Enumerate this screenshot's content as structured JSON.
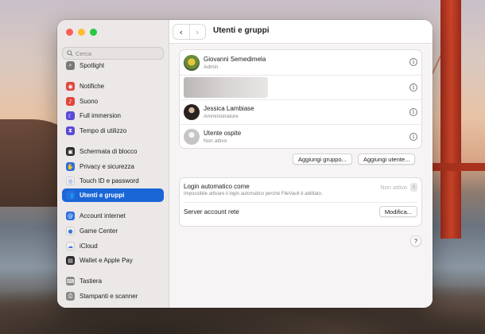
{
  "window": {
    "title": "Utenti e gruppi"
  },
  "search": {
    "placeholder": "Cerca"
  },
  "sidebar": {
    "items": [
      {
        "label": "Spotlight",
        "icon": "spotlight-icon",
        "color": "#7b7878",
        "glyph": "⌕"
      },
      {
        "label": "Notifiche",
        "icon": "notifications-icon",
        "color": "#e2463c",
        "glyph": "◉"
      },
      {
        "label": "Suono",
        "icon": "sound-icon",
        "color": "#e2463c",
        "glyph": "♪"
      },
      {
        "label": "Full immersion",
        "icon": "focus-icon",
        "color": "#5a4ad6",
        "glyph": "☾"
      },
      {
        "label": "Tempo di utilizzo",
        "icon": "screen-time-icon",
        "color": "#5a4ad6",
        "glyph": "⧗"
      },
      {
        "label": "Schermata di blocco",
        "icon": "lock-screen-icon",
        "color": "#2a2a2a",
        "glyph": "▣"
      },
      {
        "label": "Privacy e sicurezza",
        "icon": "privacy-icon",
        "color": "#2b6ee0",
        "glyph": "✋"
      },
      {
        "label": "Touch ID e password",
        "icon": "touch-id-icon",
        "color": "#f2f0f0",
        "glyph": "◎"
      },
      {
        "label": "Utenti e gruppi",
        "icon": "users-icon",
        "color": "#2b6ee0",
        "glyph": "👥"
      },
      {
        "label": "Account internet",
        "icon": "internet-accounts-icon",
        "color": "#2b6ee0",
        "glyph": "@"
      },
      {
        "label": "Game Center",
        "icon": "game-center-icon",
        "color": "#f2f0f0",
        "glyph": "●"
      },
      {
        "label": "iCloud",
        "icon": "icloud-icon",
        "color": "#f2f0f0",
        "glyph": "☁"
      },
      {
        "label": "Wallet e Apple Pay",
        "icon": "wallet-icon",
        "color": "#2a2a2a",
        "glyph": "▤"
      },
      {
        "label": "Tastiera",
        "icon": "keyboard-icon",
        "color": "#8a8787",
        "glyph": "⌨"
      },
      {
        "label": "Stampanti e scanner",
        "icon": "printer-icon",
        "color": "#8a8787",
        "glyph": "⎙"
      }
    ],
    "active_index": 8
  },
  "users": [
    {
      "name": "Giovanni Semedimela",
      "role": "Admin"
    },
    {
      "name": "",
      "role": ""
    },
    {
      "name": "Jessica Lambiase",
      "role": "Amministratore"
    },
    {
      "name": "Utente ospite",
      "role": "Non attivo"
    }
  ],
  "actions": {
    "add_group": "Aggiungi gruppo...",
    "add_user": "Aggiungi utente..."
  },
  "settings": {
    "auto_login_label": "Login automatico come",
    "auto_login_value": "Non attivo",
    "auto_login_note": "Impossibile attivare il login automatico perché FileVault è abilitato.",
    "network_server_label": "Server account rete",
    "modify_button": "Modifica..."
  },
  "help": "?",
  "colors": {
    "accent": "#1a66d6",
    "close": "#fe5f57",
    "minimize": "#febc2e",
    "zoom": "#28c840"
  }
}
